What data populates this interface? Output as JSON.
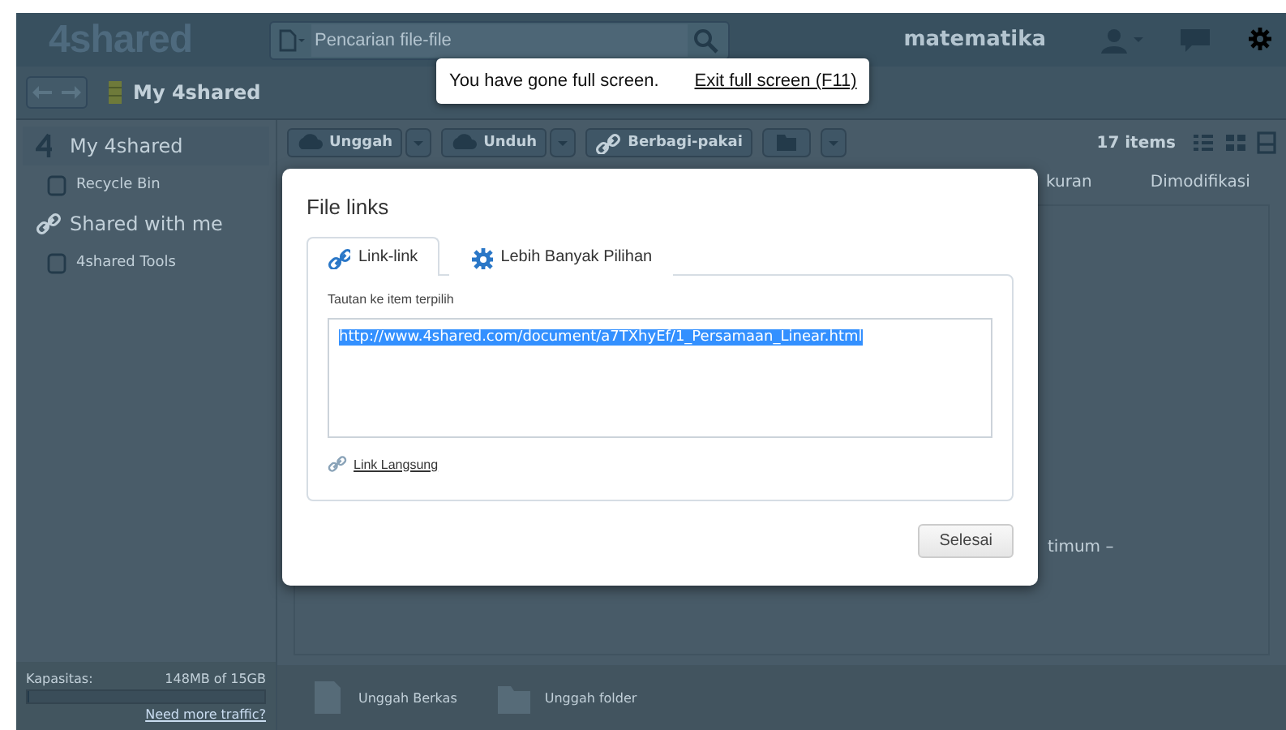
{
  "header": {
    "logo": "4shared",
    "search": {
      "placeholder": "Pencarian file-file"
    },
    "user": "matematika"
  },
  "breadcrumb": {
    "title": "My 4shared"
  },
  "sidebar": {
    "items": [
      {
        "label": "My 4shared",
        "kind": "main",
        "selected": true
      },
      {
        "label": "Recycle Bin",
        "kind": "sub",
        "selected": false
      },
      {
        "label": "Shared with me",
        "kind": "main",
        "selected": false
      },
      {
        "label": "4shared Tools",
        "kind": "sub",
        "selected": false
      }
    ],
    "capacity": {
      "label": "Kapasitas:",
      "reading": "148MB of 15GB",
      "level": 0.01,
      "link": "Need more traffic?"
    }
  },
  "toolbar": {
    "buttons": [
      {
        "label": "Unggah",
        "kind": "upload"
      },
      {
        "label": "Unduh",
        "kind": "download"
      },
      {
        "label": "Berbagi-pakai",
        "kind": "share"
      }
    ],
    "count": "17 items"
  },
  "table": {
    "columns": [
      "kuran",
      "Dimodifikasi"
    ],
    "cell": "timum –"
  },
  "bottom_bar": {
    "actions": [
      "Unggah Berkas",
      "Unggah folder"
    ]
  },
  "dialog": {
    "title": "File links",
    "tabs": [
      {
        "label": "Link-link",
        "kind": "link",
        "selected": true
      },
      {
        "label": "Lebih Banyak Pilihan",
        "kind": "gear",
        "selected": false
      }
    ],
    "field_label": "Tautan ke item terpilih",
    "value": "http://www.4shared.com/document/a7TXhyEf/1_Persamaan_Linear.html",
    "link": "Link Langsung",
    "button": "Selesai"
  },
  "notice": {
    "text": "You have gone full screen.",
    "link": "Exit full screen (F11)"
  }
}
